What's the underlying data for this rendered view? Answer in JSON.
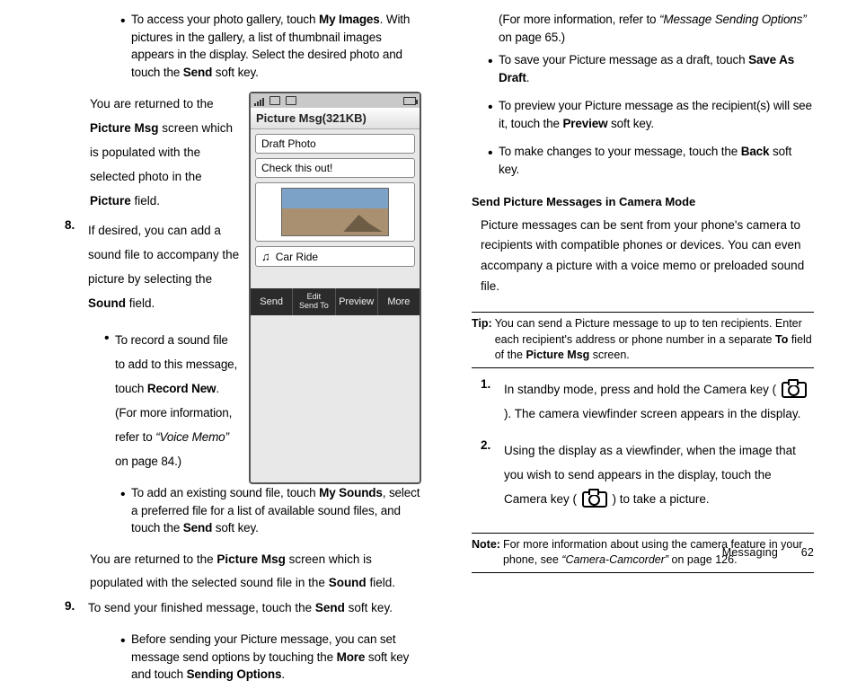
{
  "left": {
    "bullet_my_images_1": "To access your photo gallery, touch ",
    "bullet_my_images_b1": "My Images",
    "bullet_my_images_2": ". With pictures in the gallery, a list of thumbnail images appears in the display. Select the desired photo and touch the ",
    "bullet_my_images_b2": "Send",
    "bullet_my_images_3": " soft key.",
    "returned_1": "You are returned to the ",
    "returned_b1": "Picture Msg",
    "returned_2": " screen which is populated with the selected photo in the ",
    "returned_b2": "Picture",
    "returned_3": " field.",
    "step8_num": "8.",
    "step8_1": "If desired, you can add a sound file to accompany the picture by selecting the ",
    "step8_b": "Sound",
    "step8_2": " field.",
    "rec_bullet_1": "To record a sound file to add to this message, touch ",
    "rec_bullet_b": "Record New",
    "rec_bullet_2": ". (For more information, refer to ",
    "rec_bullet_i": "“Voice Memo”",
    "rec_bullet_3": "  on page 84.)",
    "sounds_bullet_1": "To add an existing sound file, touch ",
    "sounds_bullet_b": "My Sounds",
    "sounds_bullet_2": ", select a preferred file for a list of available sound files, and touch the ",
    "sounds_bullet_b2": "Send",
    "sounds_bullet_3": " soft key.",
    "returned2_1": "You are returned to the ",
    "returned2_b1": "Picture Msg",
    "returned2_2": " screen which is populated with the selected sound file in the ",
    "returned2_b2": "Sound",
    "returned2_3": " field.",
    "step9_num": "9.",
    "step9_1": "To send your finished message, touch the ",
    "step9_b": "Send",
    "step9_2": " soft key.",
    "before_send_1": "Before sending your Picture message, you can set message send options by touching the ",
    "before_send_b1": "More",
    "before_send_2": " soft key and touch ",
    "before_send_b2": "Sending Options",
    "before_send_3": "."
  },
  "phone": {
    "title": "Picture Msg(321KB)",
    "draft": "Draft Photo",
    "text_field": "Check this out!",
    "sound": "Car Ride",
    "sk_send": "Send",
    "sk_edit1": "Edit",
    "sk_edit2": "Send To",
    "sk_preview": "Preview",
    "sk_more": "More"
  },
  "right": {
    "cont_1": "(For more information, refer to ",
    "cont_i": "“Message Sending Options”",
    "cont_2": "  on page 65.)",
    "save_draft_1": "To save your Picture message as a draft, touch ",
    "save_draft_b": "Save As Draft",
    "save_draft_2": ".",
    "preview_1": "To preview your Picture message as the recipient(s) will see it, touch the ",
    "preview_b": "Preview",
    "preview_2": " soft key.",
    "back_1": "To make changes to your message, touch the ",
    "back_b": "Back",
    "back_2": " soft key.",
    "heading": "Send Picture Messages in Camera Mode",
    "para": "Picture messages can be sent from your phone's camera to recipients with compatible phones or devices. You can even accompany a picture with a voice memo or preloaded sound file.",
    "tip_label": "Tip:",
    "tip_1": "You can send a Picture message to up to ten recipients. Enter each recipient's address or phone number in a separate ",
    "tip_b1": "To",
    "tip_2": " field of the ",
    "tip_b2": "Picture Msg",
    "tip_3": " screen.",
    "cam1_num": "1.",
    "cam1_1": "In standby mode, press and hold the Camera key ( ",
    "cam1_2": " ). The camera viewfinder screen appears in the display.",
    "cam2_num": "2.",
    "cam2_1": "Using the display as a viewfinder, when the image that you wish to send appears in the display, touch the Camera key ( ",
    "cam2_2": " ) to take a picture.",
    "note_label": "Note:",
    "note_1": "For more information about using the camera feature in your phone, see ",
    "note_i": "“Camera-Camcorder”",
    "note_2": " on page 126."
  },
  "footer": {
    "section": "Messaging",
    "page": "62"
  }
}
